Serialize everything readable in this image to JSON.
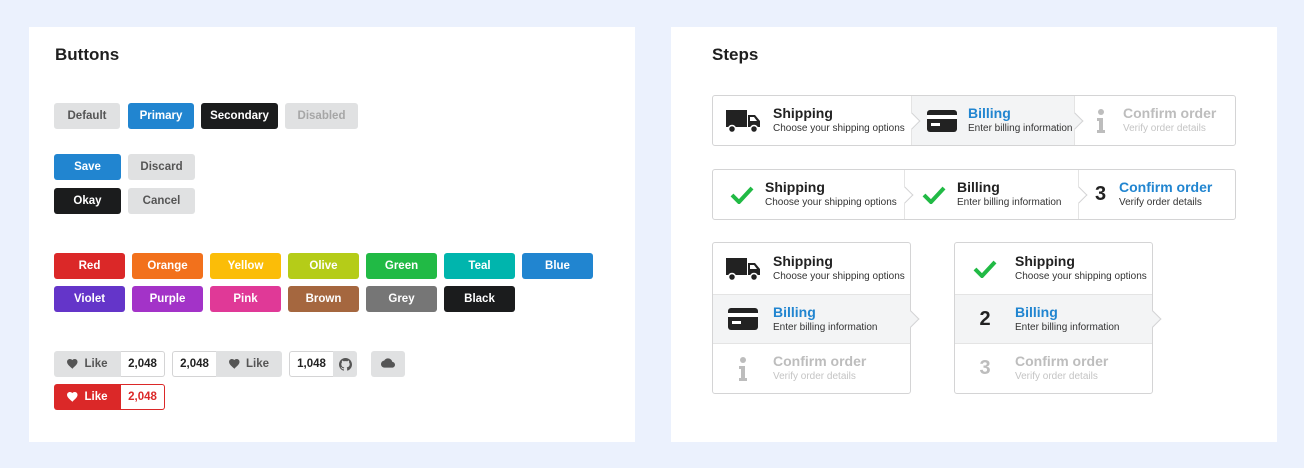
{
  "buttons_panel": {
    "title": "Buttons",
    "emphasis": [
      "Default",
      "Primary",
      "Secondary",
      "Disabled"
    ],
    "save": "Save",
    "discard": "Discard",
    "okay": "Okay",
    "cancel": "Cancel",
    "colors": [
      {
        "label": "Red",
        "color": "#db2828"
      },
      {
        "label": "Orange",
        "color": "#f2711c"
      },
      {
        "label": "Yellow",
        "color": "#fbbd08"
      },
      {
        "label": "Olive",
        "color": "#b5cc18"
      },
      {
        "label": "Green",
        "color": "#21ba45"
      },
      {
        "label": "Teal",
        "color": "#00b5ad"
      },
      {
        "label": "Blue",
        "color": "#2185d0"
      },
      {
        "label": "Violet",
        "color": "#6435c9"
      },
      {
        "label": "Purple",
        "color": "#a333c8"
      },
      {
        "label": "Pink",
        "color": "#e03997"
      },
      {
        "label": "Brown",
        "color": "#a5673f"
      },
      {
        "label": "Grey",
        "color": "#767676"
      },
      {
        "label": "Black",
        "color": "#1b1c1d"
      }
    ],
    "like_label": "Like",
    "like_count_1": "2,048",
    "like_count_2": "2,048",
    "github_count": "1,048",
    "like_count_red": "2,048",
    "icons": {
      "like": "heart-icon",
      "github": "github-icon",
      "cloud": "cloud-icon"
    }
  },
  "steps_panel": {
    "title": "Steps",
    "shipping_title": "Shipping",
    "shipping_desc": "Choose your shipping options",
    "billing_title": "Billing",
    "billing_desc": "Enter billing information",
    "confirm_title": "Confirm order",
    "confirm_desc": "Verify order details",
    "num_3": "3",
    "num_2": "2",
    "icons": {
      "shipping": "truck-icon",
      "billing": "credit-card-icon",
      "confirm": "info-icon",
      "done": "checkmark-icon"
    },
    "colors": {
      "active": "#2185d0",
      "completed": "#21ba45"
    }
  }
}
